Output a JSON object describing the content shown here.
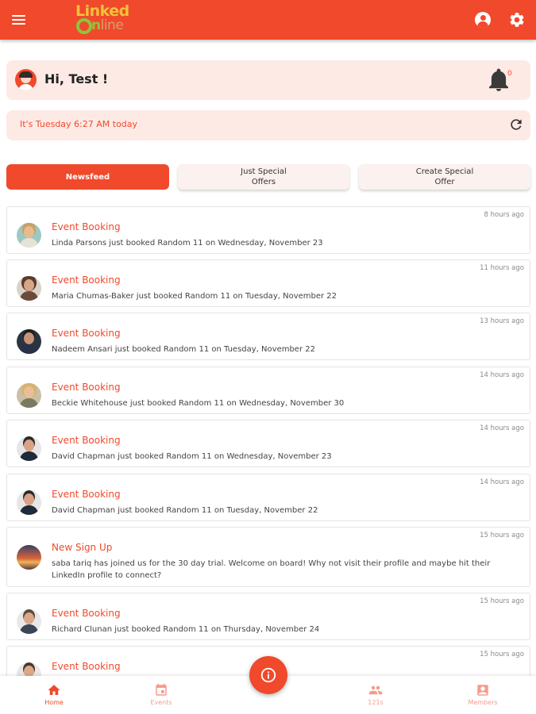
{
  "header": {
    "logo_top": "Linked",
    "logo_bottom_a": "n",
    "logo_bottom_b": "line",
    "menu_icon": "menu-icon",
    "profile_icon": "account-circle-icon",
    "settings_icon": "gear-icon"
  },
  "greeting": {
    "text": "Hi, Test !",
    "notification_count": "0"
  },
  "date_bar": {
    "text": "It's Tuesday 6:27 AM today"
  },
  "tabs": [
    {
      "line1": "Newsfeed",
      "line2": ""
    },
    {
      "line1": "Just Special",
      "line2": "Offers"
    },
    {
      "line1": "Create Special",
      "line2": "Offer"
    }
  ],
  "feed": [
    {
      "title": "Event Booking",
      "desc": "Linda Parsons just booked Random 11 on Wednesday, November 23",
      "time": "8 hours ago"
    },
    {
      "title": "Event Booking",
      "desc": "Maria Chumas-Baker just booked Random 11 on Tuesday, November 22",
      "time": "11 hours ago"
    },
    {
      "title": "Event Booking",
      "desc": "Nadeem Ansari just booked Random 11 on Tuesday, November 22",
      "time": "13 hours ago"
    },
    {
      "title": "Event Booking",
      "desc": "Beckie Whitehouse just booked Random 11 on Wednesday, November 30",
      "time": "14 hours ago"
    },
    {
      "title": "Event Booking",
      "desc": "David Chapman just booked Random 11 on Wednesday, November 23",
      "time": "14 hours ago"
    },
    {
      "title": "Event Booking",
      "desc": "David Chapman just booked Random 11 on Tuesday, November 22",
      "time": "14 hours ago"
    },
    {
      "title": "New Sign Up",
      "desc": "saba tariq has joined us for the 30 day trial. Welcome on board! Why not visit their profile and maybe hit their LinkedIn profile to connect?",
      "time": "15 hours ago"
    },
    {
      "title": "Event Booking",
      "desc": "Richard Clunan  just booked Random 11 on Thursday, November 24",
      "time": "15 hours ago"
    },
    {
      "title": "Event Booking",
      "desc": "",
      "time": "15 hours ago"
    }
  ],
  "bottom_nav": [
    {
      "label": "Home",
      "icon": "home-icon"
    },
    {
      "label": "Events",
      "icon": "calendar-icon"
    },
    {
      "label": "121s",
      "icon": "people-icon"
    },
    {
      "label": "Members",
      "icon": "member-badge-icon"
    }
  ],
  "colors": {
    "brand": "#f0492b",
    "card_tint": "#fdeae5",
    "logo_yellow": "#f2c23a",
    "logo_green": "#8fc43d"
  }
}
